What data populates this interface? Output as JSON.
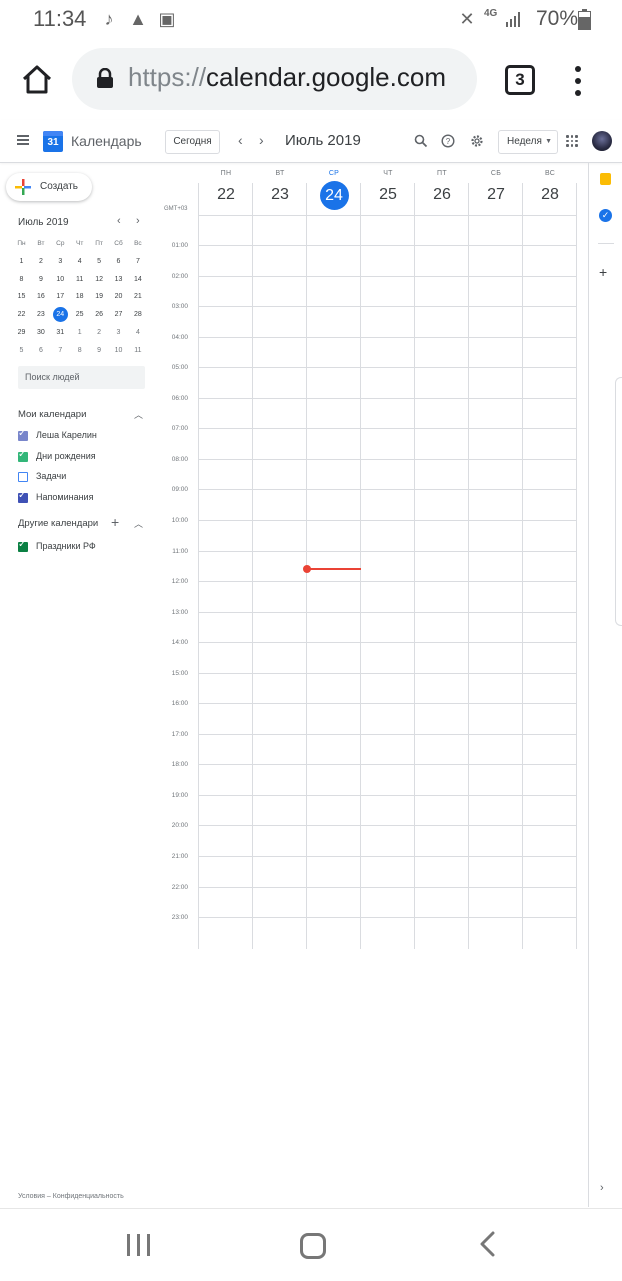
{
  "status_bar": {
    "time": "11:34",
    "network": "4G",
    "battery": "70%",
    "icons": [
      "music-sync-icon",
      "navigation-icon",
      "image-icon",
      "mute-icon",
      "signal-icon",
      "battery-icon"
    ]
  },
  "browser": {
    "url_scheme": "https://",
    "url_host": "calendar.google.com",
    "tab_count": "3"
  },
  "header": {
    "app_title": "Календарь",
    "logo_day": "31",
    "today_button": "Сегодня",
    "month_title": "Июль 2019",
    "view_select": "Неделя"
  },
  "sidebar": {
    "create_label": "Создать",
    "mini_calendar": {
      "title": "Июль 2019",
      "weekday_heads": [
        "Пн",
        "Вт",
        "Ср",
        "Чт",
        "Пт",
        "Сб",
        "Вс"
      ],
      "weeks": [
        [
          "1",
          "2",
          "3",
          "4",
          "5",
          "6",
          "7"
        ],
        [
          "8",
          "9",
          "10",
          "11",
          "12",
          "13",
          "14"
        ],
        [
          "15",
          "16",
          "17",
          "18",
          "19",
          "20",
          "21"
        ],
        [
          "22",
          "23",
          "24",
          "25",
          "26",
          "27",
          "28"
        ],
        [
          "29",
          "30",
          "31",
          "1",
          "2",
          "3",
          "4"
        ],
        [
          "5",
          "6",
          "7",
          "8",
          "9",
          "10",
          "11"
        ]
      ],
      "today": "24"
    },
    "people_search_placeholder": "Поиск людей",
    "my_calendars_title": "Мои календари",
    "my_calendars": [
      {
        "label": "Леша Карелин",
        "checked": true,
        "color": "#7986cb"
      },
      {
        "label": "Дни рождения",
        "checked": true,
        "color": "#33b679"
      },
      {
        "label": "Задачи",
        "checked": false,
        "color": "#4285f4"
      },
      {
        "label": "Напоминания",
        "checked": true,
        "color": "#3f51b5"
      }
    ],
    "other_calendars_title": "Другие календари",
    "other_calendars": [
      {
        "label": "Праздники РФ",
        "checked": true,
        "color": "#0b8043"
      }
    ],
    "footer": "Условия – Конфиденциальность"
  },
  "week": {
    "timezone": "GMT+03",
    "days": [
      {
        "name": "ПН",
        "date": "22",
        "today": false
      },
      {
        "name": "ВТ",
        "date": "23",
        "today": false
      },
      {
        "name": "СР",
        "date": "24",
        "today": true
      },
      {
        "name": "ЧТ",
        "date": "25",
        "today": false
      },
      {
        "name": "ПТ",
        "date": "26",
        "today": false
      },
      {
        "name": "СБ",
        "date": "27",
        "today": false
      },
      {
        "name": "ВС",
        "date": "28",
        "today": false
      }
    ],
    "hours": [
      "01:00",
      "02:00",
      "03:00",
      "04:00",
      "05:00",
      "06:00",
      "07:00",
      "08:00",
      "09:00",
      "10:00",
      "11:00",
      "12:00",
      "13:00",
      "14:00",
      "15:00",
      "16:00",
      "17:00",
      "18:00",
      "19:00",
      "20:00",
      "21:00",
      "22:00",
      "23:00"
    ],
    "current_time": "11:34"
  },
  "colors": {
    "accent": "#1a73e8",
    "now_indicator": "#ea4335",
    "grid_line": "#dadce0"
  }
}
